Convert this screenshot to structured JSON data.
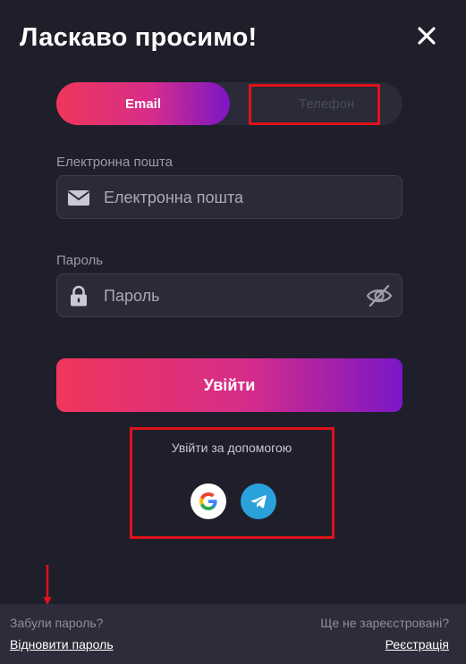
{
  "header": {
    "title": "Ласкаво просимо!"
  },
  "tabs": [
    {
      "label": "Email",
      "active": true
    },
    {
      "label": "Телефон",
      "active": false
    }
  ],
  "email": {
    "label": "Електронна пошта",
    "placeholder": "Електронна пошта",
    "value": ""
  },
  "password": {
    "label": "Пароль",
    "placeholder": "Пароль",
    "value": ""
  },
  "login_button": {
    "label": "Увійти"
  },
  "social": {
    "title": "Увійти за допомогою",
    "providers": [
      "google-icon",
      "telegram-icon"
    ]
  },
  "footer": {
    "forgot_question": "Забули пароль?",
    "restore_link": "Відновити пароль",
    "not_registered": "Ще не зареєстровані?",
    "register_link": "Реєстрація"
  },
  "colors": {
    "background": "#1f1f2b",
    "gradient_start": "#f0365b",
    "gradient_end": "#7b16c6",
    "highlight": "#e0121b"
  }
}
